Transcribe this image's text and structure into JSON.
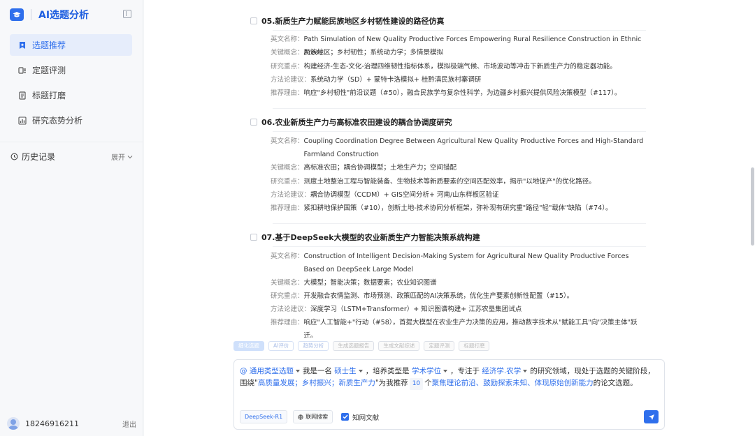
{
  "app": {
    "title": "AI选题分析"
  },
  "nav": {
    "items": [
      {
        "label": "选题推荐",
        "active": true
      },
      {
        "label": "定题评测"
      },
      {
        "label": "标题打磨"
      },
      {
        "label": "研究态势分析"
      }
    ]
  },
  "history": {
    "label": "历史记录",
    "expand": "展开"
  },
  "user": {
    "phone": "18246916211",
    "logout": "退出"
  },
  "items": [
    {
      "title": "05.新质生产力赋能民族地区乡村韧性建设的路径仿真",
      "fields": [
        {
          "label": "英文名称：",
          "value": "Path Simulation of New Quality Productive Forces Empowering Rural Resilience Construction in Ethnic Areas"
        },
        {
          "label": "关键概念：",
          "value": "民族地区；乡村韧性；系统动力学；多情景模拟"
        },
        {
          "label": "研究重点：",
          "value": "构建经济-生态-文化-治理四维韧性指标体系，模拟极端气候、市场波动等冲击下新质生产力的稳定器功能。"
        },
        {
          "label": "方法论建议：",
          "value": "系统动力学（SD）+ 蒙特卡洛模拟+ 桂黔滇民族村寨调研"
        },
        {
          "label": "推荐理由：",
          "value": "响应\"乡村韧性\"前沿议题（#50），融合民族学与复杂性科学，为边疆乡村振兴提供风险决策模型（#117）。"
        }
      ]
    },
    {
      "title": "06.农业新质生产力与高标准农田建设的耦合协调度研究",
      "fields": [
        {
          "label": "英文名称：",
          "value": "Coupling Coordination Degree Between Agricultural New Quality Productive Forces and High-Standard Farmland Construction"
        },
        {
          "label": "关键概念：",
          "value": "高标准农田；耦合协调模型；土地生产力；空间错配"
        },
        {
          "label": "研究重点：",
          "value": "测度土地整治工程与智能装备、生物技术等新质要素的空间匹配效率，揭示\"以地促产\"的优化路径。"
        },
        {
          "label": "方法论建议：",
          "value": "耦合协调模型（CCDM）+ GIS空间分析+ 河南/山东样板区验证"
        },
        {
          "label": "推荐理由：",
          "value": "紧扣耕地保护国策（#10），创新土地-技术协同分析框架，弥补现有研究重\"路径\"轻\"载体\"缺陷（#74）。"
        }
      ]
    },
    {
      "title": "07.基于DeepSeek大模型的农业新质生产力智能决策系统构建",
      "fields": [
        {
          "label": "英文名称：",
          "value": "Construction of Intelligent Decision-Making System for Agricultural New Quality Productive Forces Based on DeepSeek Large Model"
        },
        {
          "label": "关键概念：",
          "value": "大模型；智能决策；数据要素；农业知识图谱"
        },
        {
          "label": "研究重点：",
          "value": "开发融合农情监测、市场预测、政策匹配的AI决策系统，优化生产要素创新性配置（#15）。"
        },
        {
          "label": "方法论建议：",
          "value": "深度学习（LSTM+Transformer）+ 知识图谱构建+ 江苏农垦集团试点"
        },
        {
          "label": "推荐理由：",
          "value": "响应\"人工智能+\"行动（#58），首提大模型在农业生产力决策的应用，推动数字技术从\"赋能工具\"向\"决策主体\"跃迁。"
        }
      ]
    }
  ],
  "tags": [
    "细化选题",
    "AI评价",
    "趋势分析",
    "生成选题报告",
    "生成文献综述",
    "定题评测",
    "标题打磨"
  ],
  "composer": {
    "type_select": "@ 通用类型选题",
    "p1": "我是一名",
    "degree": "硕士生",
    "p2": "，培养类型是",
    "train_type": "学术学位",
    "p3": "，专注于",
    "field": "经济学.农学",
    "p4": "的研究领域，现处于选题的关键阶段，围绕\"",
    "keywords": "高质量发展；乡村振兴；新质生产力",
    "p5": "\"为我推荐",
    "count": "10",
    "p6": "个",
    "direction": "聚焦理论前沿、鼓励探索未知、体现原始创新能力",
    "p7": "的论文选题。",
    "model": "DeepSeek-R1",
    "web_search": "联网搜索",
    "knowledge": "知网文献"
  },
  "colors": {
    "accent": "#2f6fec",
    "active_bg": "#e6edfb"
  }
}
